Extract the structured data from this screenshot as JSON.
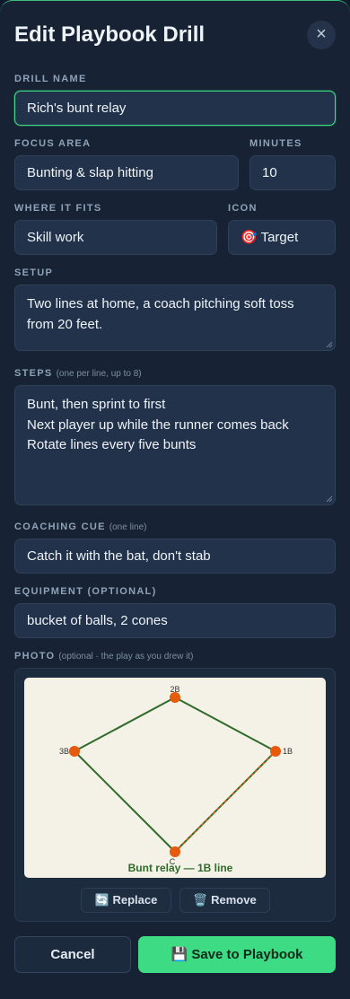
{
  "header": {
    "title": "Edit Playbook Drill",
    "close_glyph": "×"
  },
  "fields": {
    "drill_name": {
      "label": "DRILL NAME",
      "value": "Rich's bunt relay"
    },
    "focus_area": {
      "label": "FOCUS AREA",
      "value": "Bunting & slap hitting"
    },
    "minutes": {
      "label": "MINUTES",
      "value": "10"
    },
    "where_it_fits": {
      "label": "WHERE IT FITS",
      "value": "Skill work"
    },
    "icon": {
      "label": "ICON",
      "emoji": "🎯",
      "value": "Target"
    },
    "setup": {
      "label": "SETUP",
      "lines": [
        "Two lines at home, a coach pitching soft toss",
        "from 20 feet."
      ]
    },
    "steps": {
      "label": "STEPS",
      "hint": "(one per line, up to 8)",
      "lines": [
        "Bunt, then sprint to first",
        "Next player up while the runner comes back",
        "Rotate lines every five bunts"
      ]
    },
    "coaching_cue": {
      "label": "COACHING CUE",
      "hint": "(one line)",
      "value": "Catch it with the bat, don't stab"
    },
    "equipment": {
      "label": "EQUIPMENT (OPTIONAL)",
      "value": "bucket of balls, 2 cones"
    },
    "photo": {
      "label": "PHOTO",
      "hint": "(optional · the play as you drew it)"
    }
  },
  "photo_diagram": {
    "bases": [
      {
        "id": "2B",
        "label": "2B"
      },
      {
        "id": "1B",
        "label": "1B"
      },
      {
        "id": "3B",
        "label": "3B"
      },
      {
        "id": "C",
        "label": "C"
      }
    ],
    "caption": "Bunt relay — 1B line",
    "line_color": "#2f6b2a",
    "highlight_color": "#c9641a",
    "base_color": "#e55a0c"
  },
  "photo_actions": {
    "replace": {
      "icon": "🔄",
      "label": "Replace"
    },
    "remove": {
      "icon": "🗑️",
      "label": "Remove"
    }
  },
  "footer": {
    "cancel_label": "Cancel",
    "save_icon": "💾",
    "save_label": "Save to Playbook"
  },
  "colors": {
    "accent": "#3ddc84",
    "panel": "#172334",
    "field": "#22324a"
  }
}
